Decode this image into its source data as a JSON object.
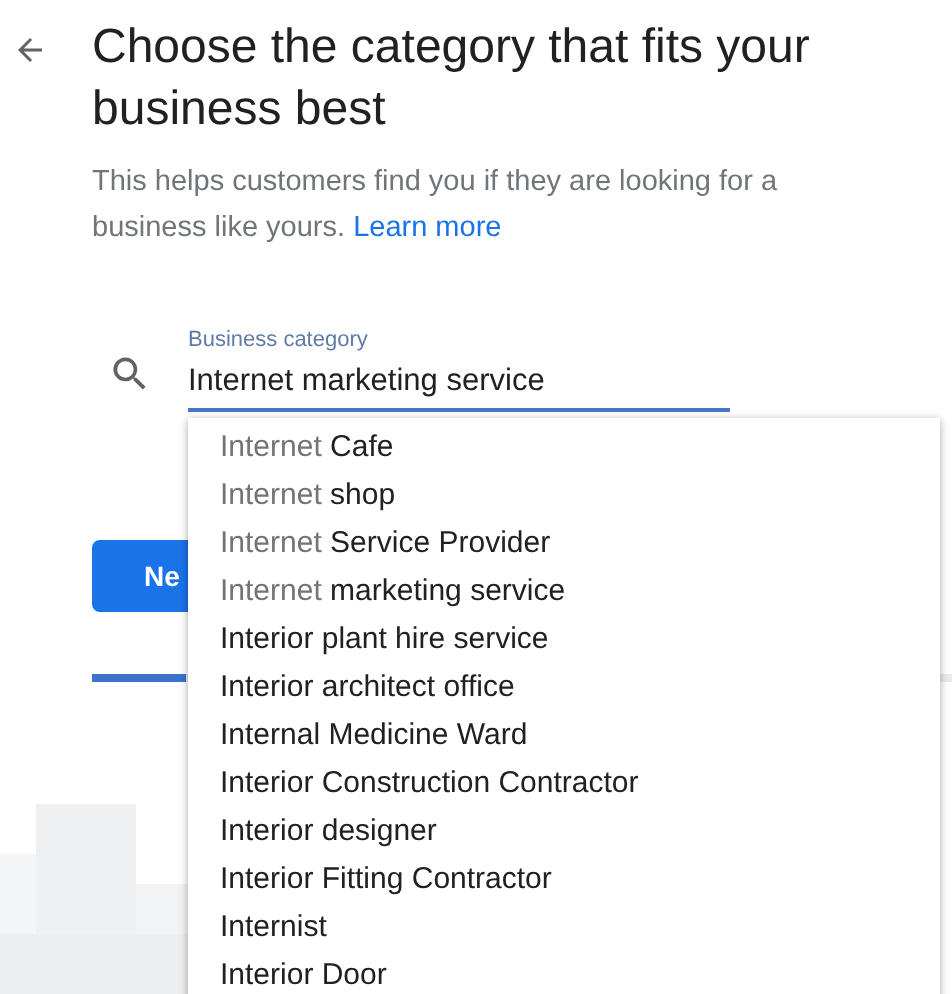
{
  "title": "Choose the category that fits your business best",
  "description": "This helps customers find you if they are looking for a business like yours.",
  "learn_more": "Learn more",
  "field": {
    "label": "Business category",
    "value": "Internet marketing service"
  },
  "next_button": "Ne",
  "progress": {
    "level": 0.11
  },
  "suggestions": [
    {
      "match": "Internet",
      "rest": " Cafe"
    },
    {
      "match": "Internet",
      "rest": " shop"
    },
    {
      "match": "Internet",
      "rest": " Service Provider"
    },
    {
      "match": "Internet",
      "rest": " marketing service"
    },
    {
      "rest": "Interior plant hire service"
    },
    {
      "rest": "Interior architect office"
    },
    {
      "rest": "Internal Medicine Ward"
    },
    {
      "rest": "Interior Construction Contractor"
    },
    {
      "rest": "Interior designer"
    },
    {
      "rest": "Interior Fitting Contractor"
    },
    {
      "rest": "Internist"
    },
    {
      "rest": "Interior Door"
    }
  ]
}
